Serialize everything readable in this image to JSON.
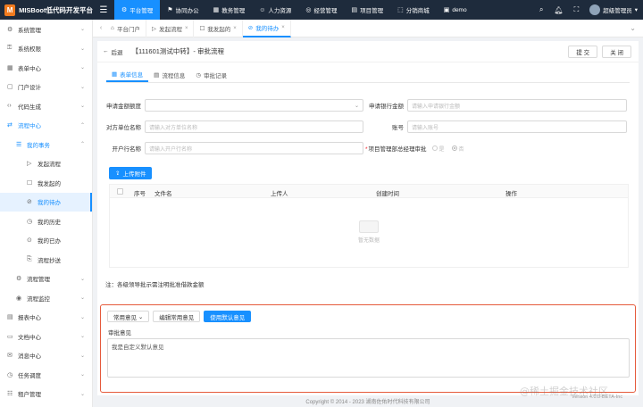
{
  "app": {
    "logo_text": "MISBoot低代码开发平台",
    "logo_mark": "M"
  },
  "topnav": [
    {
      "icon": "⚙",
      "label": "平台管理",
      "active": true
    },
    {
      "icon": "⚑",
      "label": "协同办公"
    },
    {
      "icon": "▦",
      "label": "教务管理"
    },
    {
      "icon": "☺",
      "label": "人力资源"
    },
    {
      "icon": "◎",
      "label": "经营管理"
    },
    {
      "icon": "▤",
      "label": "项目管理"
    },
    {
      "icon": "⬚",
      "label": "分销商城"
    },
    {
      "icon": "▣",
      "label": "demo"
    }
  ],
  "user": {
    "name": "超级管理员"
  },
  "sidebar": {
    "items": [
      {
        "icon": "⚙",
        "label": "系统管理",
        "arrow": "⌄"
      },
      {
        "icon": "⚿",
        "label": "系统权限",
        "arrow": "⌄"
      },
      {
        "icon": "▦",
        "label": "表单中心",
        "arrow": "⌄"
      },
      {
        "icon": "▢",
        "label": "门户设计",
        "arrow": "⌄"
      },
      {
        "icon": "‹›",
        "label": "代码生成",
        "arrow": "⌄"
      },
      {
        "icon": "⇄",
        "label": "流程中心",
        "arrow": "⌃",
        "open": true
      },
      {
        "icon": "☰",
        "label": "我的事务",
        "arrow": "⌃",
        "open": true,
        "level": 1
      },
      {
        "icon": "▷",
        "label": "发起流程",
        "level": 2
      },
      {
        "icon": "☐",
        "label": "我发起的",
        "level": 2
      },
      {
        "icon": "⊘",
        "label": "我的待办",
        "level": 2,
        "active": true
      },
      {
        "icon": "◷",
        "label": "我的历史",
        "level": 2
      },
      {
        "icon": "⊙",
        "label": "我的已办",
        "level": 2
      },
      {
        "icon": "⎘",
        "label": "流程抄送",
        "level": 2
      },
      {
        "icon": "⚙",
        "label": "流程管理",
        "arrow": "⌄",
        "level": 1
      },
      {
        "icon": "◉",
        "label": "流程监控",
        "arrow": "⌄",
        "level": 1
      },
      {
        "icon": "▤",
        "label": "报表中心",
        "arrow": "⌄"
      },
      {
        "icon": "▭",
        "label": "文档中心",
        "arrow": "⌄"
      },
      {
        "icon": "✉",
        "label": "消息中心",
        "arrow": "⌄"
      },
      {
        "icon": "◷",
        "label": "任务调度",
        "arrow": "⌄"
      },
      {
        "icon": "☷",
        "label": "租户管理",
        "arrow": "⌄"
      }
    ]
  },
  "pagetabs": [
    {
      "icon": "⌂",
      "label": "平台门户"
    },
    {
      "icon": "▷",
      "label": "发起流程",
      "close": "×"
    },
    {
      "icon": "☐",
      "label": "我发起的",
      "close": "×"
    },
    {
      "icon": "⊘",
      "label": "我的待办",
      "close": "×",
      "active": true
    }
  ],
  "header": {
    "back": "后退",
    "title": "【111601测试中转】- 审批流程",
    "submit": "提 交",
    "close": "关 闭"
  },
  "formtabs": [
    {
      "icon": "▦",
      "label": "表单信息",
      "active": true
    },
    {
      "icon": "▤",
      "label": "流程信息"
    },
    {
      "icon": "◷",
      "label": "审批记录"
    }
  ],
  "form": {
    "amount_label": "申请金额额度",
    "bank_label": "申请银行金额",
    "bank_placeholder": "请输入申请银行金额",
    "payee_label": "对方单位名称",
    "payee_placeholder": "请输入对方单位名称",
    "account_label": "账号",
    "account_placeholder": "请输入账号",
    "openbank_label": "开户行名称",
    "openbank_placeholder": "请输入开户行名称",
    "approve_label": "项目管理部总经理审批",
    "approve_yes": "是",
    "approve_no": "否"
  },
  "upload": {
    "label": "上传附件"
  },
  "table": {
    "columns": [
      "序号",
      "文件名",
      "上传人",
      "创建时间",
      "操作"
    ],
    "empty_text": "暂无数据"
  },
  "note": "注：各级领导批示需注明批准借款金额",
  "opinion": {
    "common_btn": "常用意见",
    "edit_btn": "编辑常用意见",
    "default_btn": "使用默认意见",
    "label": "审批意见",
    "text": "我是自定义默认意见"
  },
  "footer": {
    "copyright": "Copyright © 2014 - 2023 湖南佐佑时代科技有限公司",
    "version": "Version 4.0.0-BETA-Inc",
    "watermark": "@稀土掘金技术社区"
  }
}
